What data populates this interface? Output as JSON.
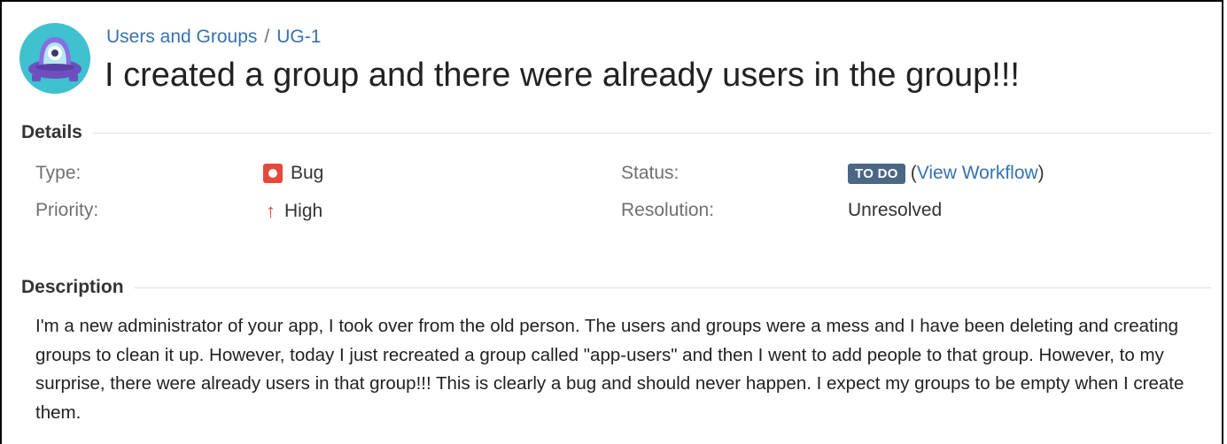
{
  "breadcrumb": {
    "project": "Users and Groups",
    "separator": "/",
    "issue_key": "UG-1"
  },
  "issue": {
    "title": "I created a group and there were already users in the group!!!"
  },
  "details": {
    "heading": "Details",
    "type_label": "Type:",
    "type_value": "Bug",
    "priority_label": "Priority:",
    "priority_value": "High",
    "status_label": "Status:",
    "status_value": "TO DO",
    "workflow_open": "(",
    "workflow_link": "View Workflow",
    "workflow_close": ")",
    "resolution_label": "Resolution:",
    "resolution_value": "Unresolved"
  },
  "description": {
    "heading": "Description",
    "text": "I'm a new administrator of your app, I took over from the old person. The users and groups were a mess and I have been deleting and creating groups to clean it up. However, today I just recreated a group called \"app-users\" and then I went to add people to that group. However, to my surprise, there were already users in that group!!! This is clearly a bug and should never happen. I expect my groups to be empty when I create them."
  },
  "icons": {
    "project_avatar": "project-avatar-icon",
    "type": "bug-icon",
    "priority": "arrow-up-icon"
  },
  "colors": {
    "link": "#3572b0",
    "bug": "#e5493a",
    "priority_high": "#e5493a",
    "status_lozenge": "#4a6785",
    "avatar_bg": "#3fc1cf",
    "avatar_ufo": "#6e4fbf"
  }
}
